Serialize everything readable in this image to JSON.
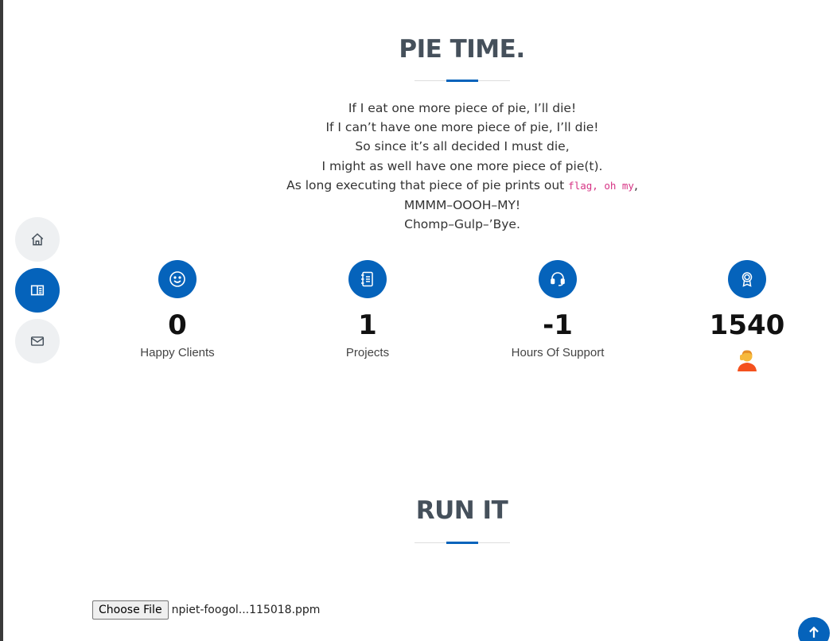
{
  "nav": {
    "items": [
      {
        "name": "home",
        "icon": "home-icon",
        "active": false
      },
      {
        "name": "about",
        "icon": "book-icon",
        "active": true
      },
      {
        "name": "contact",
        "icon": "envelope-icon",
        "active": false
      }
    ]
  },
  "pie_section": {
    "title": "PIE TIME.",
    "poem": {
      "line1": "If I eat one more piece of pie, I’ll die!",
      "line2": "If I can’t have one more piece of pie, I’ll die!",
      "line3": "So since it’s all decided I must die,",
      "line4": "I might as well have one more piece of pie(t).",
      "line5_prefix": "As long executing that piece of pie prints out ",
      "line5_code": "flag, oh my",
      "line5_suffix": ",",
      "line6": "MMMM–OOOH–MY!",
      "line7": "Chomp–Gulp–’Bye."
    }
  },
  "stats": [
    {
      "icon": "smile-icon",
      "value": "0",
      "label": "Happy Clients"
    },
    {
      "icon": "journal-icon",
      "value": "1",
      "label": "Projects"
    },
    {
      "icon": "headset-icon",
      "value": "-1",
      "label": "Hours Of Support"
    },
    {
      "icon": "award-icon",
      "value": "1540",
      "emoji": "person-emoji"
    }
  ],
  "run_section": {
    "title": "RUN IT",
    "file_button": "Choose File",
    "file_name": "npiet-foogol...115018.ppm"
  },
  "colors": {
    "accent": "#0563bb",
    "title": "#45505b",
    "code": "#d63384"
  },
  "back_to_top_icon": "arrow-up-icon"
}
